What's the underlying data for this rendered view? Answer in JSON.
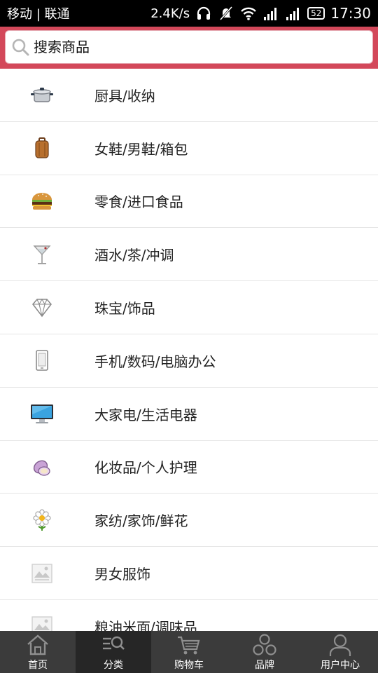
{
  "status_bar": {
    "carrier": "移动 | 联通",
    "network_speed": "2.4K/s",
    "battery": "52",
    "time": "17:30"
  },
  "search": {
    "placeholder": "搜索商品"
  },
  "categories": [
    {
      "label": "厨具/收纳",
      "icon": "pot-icon"
    },
    {
      "label": "女鞋/男鞋/箱包",
      "icon": "luggage-icon"
    },
    {
      "label": "零食/进口食品",
      "icon": "burger-icon"
    },
    {
      "label": "酒水/茶/冲调",
      "icon": "cocktail-icon"
    },
    {
      "label": "珠宝/饰品",
      "icon": "diamond-icon"
    },
    {
      "label": "手机/数码/电脑办公",
      "icon": "phone-icon"
    },
    {
      "label": "大家电/生活电器",
      "icon": "monitor-icon"
    },
    {
      "label": "化妆品/个人护理",
      "icon": "compact-icon"
    },
    {
      "label": "家纺/家饰/鲜花",
      "icon": "flower-icon"
    },
    {
      "label": "男女服饰",
      "icon": "image-placeholder-icon"
    },
    {
      "label": "粮油米面/调味品",
      "icon": "image-placeholder-icon"
    }
  ],
  "bottom_nav": {
    "items": [
      {
        "label": "首页",
        "icon": "home-icon"
      },
      {
        "label": "分类",
        "icon": "category-search-icon"
      },
      {
        "label": "购物车",
        "icon": "cart-icon"
      },
      {
        "label": "品牌",
        "icon": "brand-icon"
      },
      {
        "label": "用户中心",
        "icon": "user-icon"
      }
    ],
    "active_index": 1
  },
  "colors": {
    "header_accent": "#d3485a",
    "nav_background": "#3b3b3b",
    "nav_active": "#262626"
  }
}
